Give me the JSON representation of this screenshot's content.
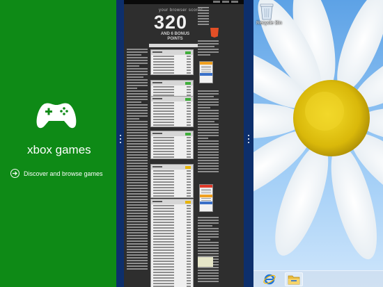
{
  "xbox_app": {
    "title": "xbox games",
    "nav_label": "Discover and browse games",
    "icons": {
      "logo": "game-controller-icon",
      "nav": "circle-arrow-icon"
    },
    "colors": {
      "background": "#0e8a16",
      "foreground": "#ffffff"
    }
  },
  "browser_page": {
    "tagline": "your browser scores",
    "score": "320",
    "bonus_line1": "AND 6 BONUS",
    "bonus_line2": "POINTS"
  },
  "desktop": {
    "recycle_bin_label": "Recycle Bin",
    "taskbar": {
      "items": [
        "internet-explorer-icon",
        "file-explorer-icon"
      ]
    },
    "colors": {
      "accent": "#0d2f6c"
    }
  }
}
